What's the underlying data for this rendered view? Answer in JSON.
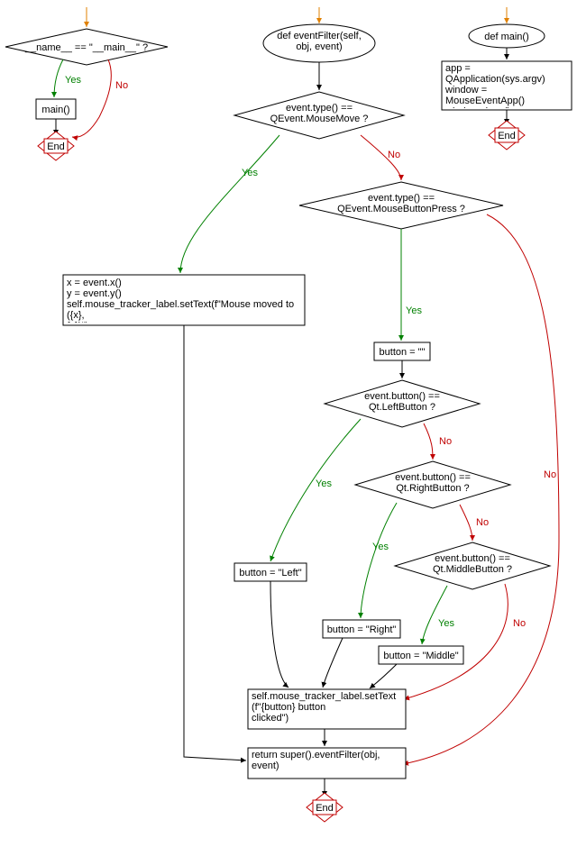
{
  "labels": {
    "yes": "Yes",
    "no": "No",
    "end": "End"
  },
  "flow1": {
    "cond": "__name__ == \"__main__\" ?",
    "call": "main()"
  },
  "flow2": {
    "def": "def eventFilter(self,\nobj, event)",
    "cond_move": "event.type() ==\nQEvent.MouseMove ?",
    "cond_press": "event.type() ==\nQEvent.MouseButtonPress ?",
    "move_block": "x = event.x()\ny = event.y()\nself.mouse_tracker_label.setText(f\"Mouse moved to ({x},\n{y})\")",
    "btn_init": "button = \"\"",
    "cond_left": "event.button() ==\nQt.LeftButton ?",
    "cond_right": "event.button() ==\nQt.RightButton ?",
    "cond_mid": "event.button() ==\nQt.MiddleButton ?",
    "btn_left": "button = \"Left\"",
    "btn_right": "button = \"Right\"",
    "btn_mid": "button = \"Middle\"",
    "set_text": "self.mouse_tracker_label.setText\n(f\"{button} button\nclicked\")",
    "ret": "return super().eventFilter(obj,\nevent)"
  },
  "flow3": {
    "def": "def main()",
    "body": "app = QApplication(sys.argv)\nwindow = MouseEventApp()\nwindow.show()\nsys.exit(app.exec_())"
  }
}
